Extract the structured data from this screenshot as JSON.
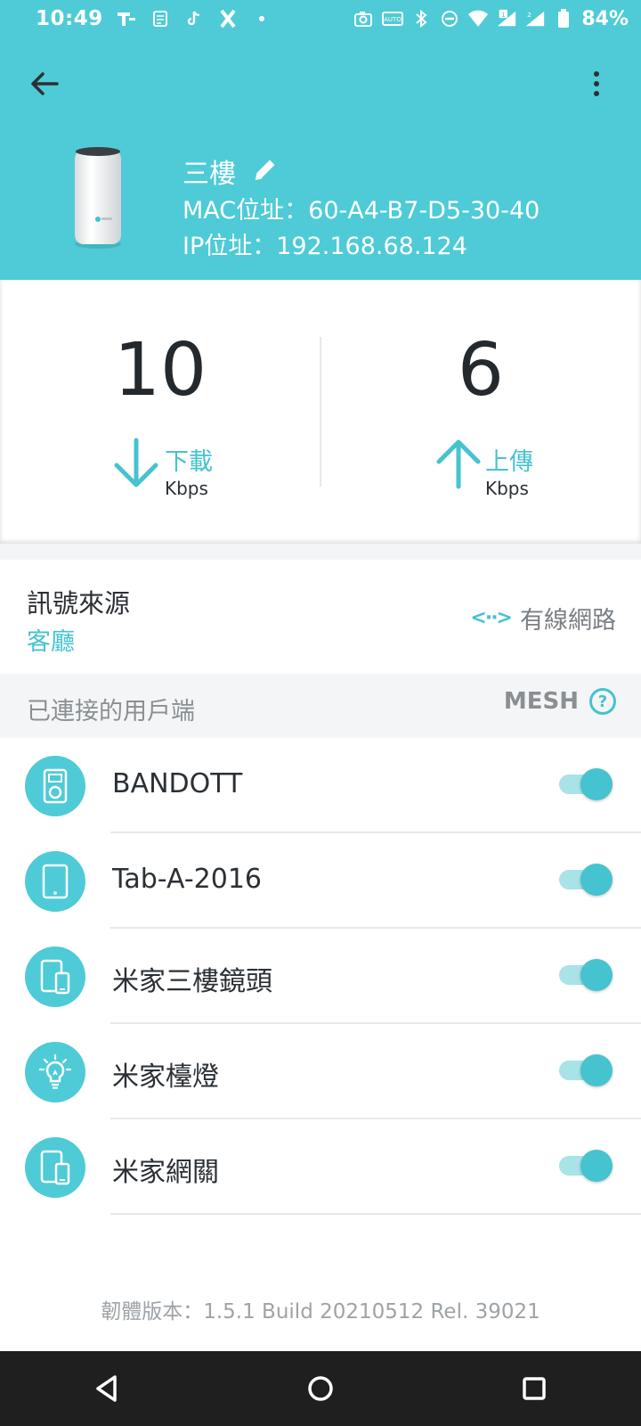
{
  "status_bar": {
    "time": "10:49",
    "battery": "84%"
  },
  "header": {
    "device_name": "三樓",
    "mac": "MAC位址：60-A4-B7-D5-30-40",
    "ip": "IP位址：192.168.68.124"
  },
  "speed": {
    "download": {
      "value": "10",
      "label": "下載",
      "unit": "Kbps"
    },
    "upload": {
      "value": "6",
      "label": "上傳",
      "unit": "Kbps"
    }
  },
  "signal": {
    "title": "訊號來源",
    "source": "客廳",
    "connection_icon": "<··>",
    "connection": "有線網路"
  },
  "clients": {
    "title": "已連接的用戶端",
    "mesh_label": "MESH",
    "items": [
      {
        "name": "BANDOTT",
        "icon": "media-player-icon",
        "enabled": true
      },
      {
        "name": "Tab-A-2016",
        "icon": "tablet-icon",
        "enabled": true
      },
      {
        "name": "米家三樓鏡頭",
        "icon": "devices-icon",
        "enabled": true
      },
      {
        "name": "米家檯燈",
        "icon": "lightbulb-icon",
        "enabled": true
      },
      {
        "name": "米家網關",
        "icon": "devices-icon",
        "enabled": true
      }
    ]
  },
  "footer": {
    "firmware": "韌體版本：1.5.1 Build 20210512 Rel. 39021"
  },
  "colors": {
    "accent": "#4ecbd6",
    "accent_text": "#45c3cf",
    "nav_bar": "#1f1f1f"
  }
}
